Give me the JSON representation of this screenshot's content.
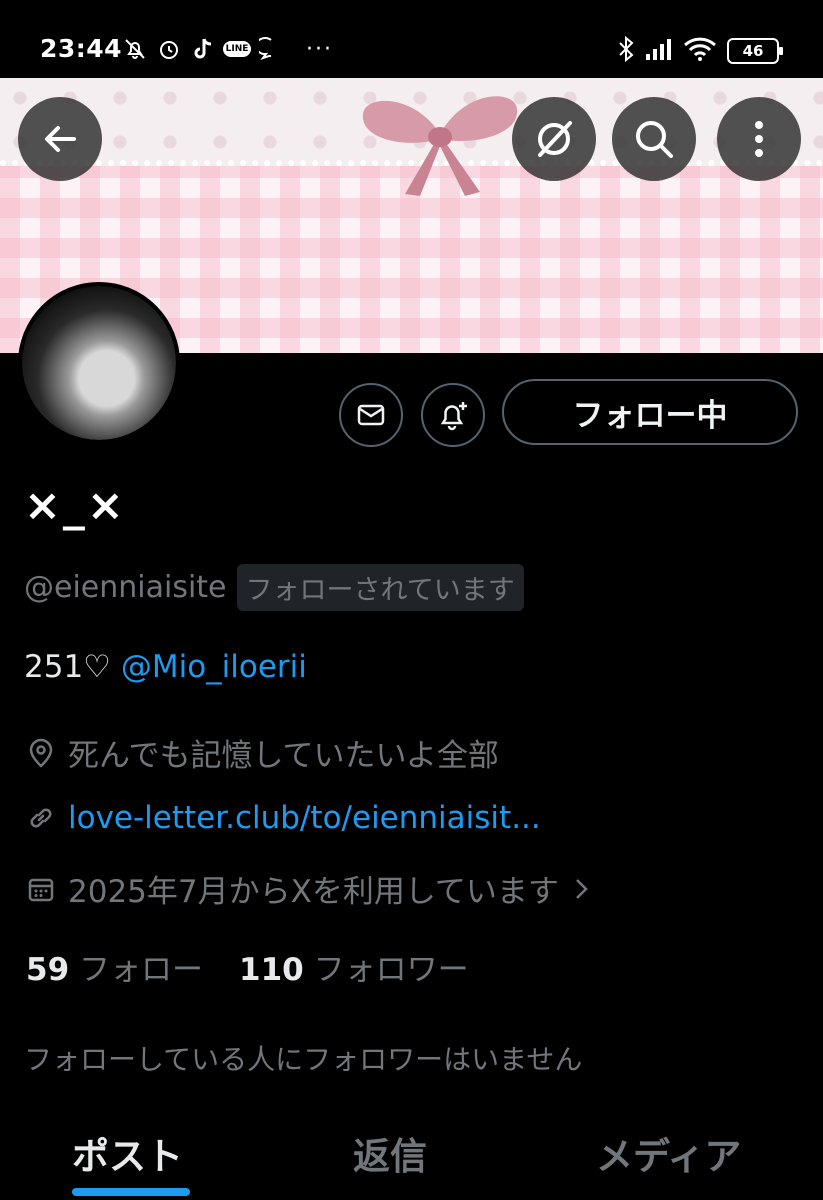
{
  "status_bar": {
    "time": "23:44",
    "line_label": "LINE",
    "more": "···",
    "battery": "46"
  },
  "profile": {
    "display_name": "×_×",
    "handle": "@eienniaisite",
    "follows_you": "フォローされています",
    "bio_text": "251♡ ",
    "bio_mention": "@Mio_iloerii",
    "location": "死んでも記憶していたいよ全部",
    "website": "love-letter.club/to/eienniaisit...",
    "joined": "2025年7月からXを利用しています"
  },
  "actions": {
    "follow_label": "フォロー中"
  },
  "stats": {
    "following_count": "59",
    "following_label": "フォロー",
    "followers_count": "110",
    "followers_label": "フォロワー"
  },
  "known_followers": "フォローしている人にフォロワーはいません",
  "tabs": [
    {
      "label": "ポスト",
      "active": true
    },
    {
      "label": "返信",
      "active": false
    },
    {
      "label": "メディア",
      "active": false
    }
  ],
  "colors": {
    "accent": "#1d9bf0",
    "muted": "#71767b",
    "background": "#000000"
  }
}
